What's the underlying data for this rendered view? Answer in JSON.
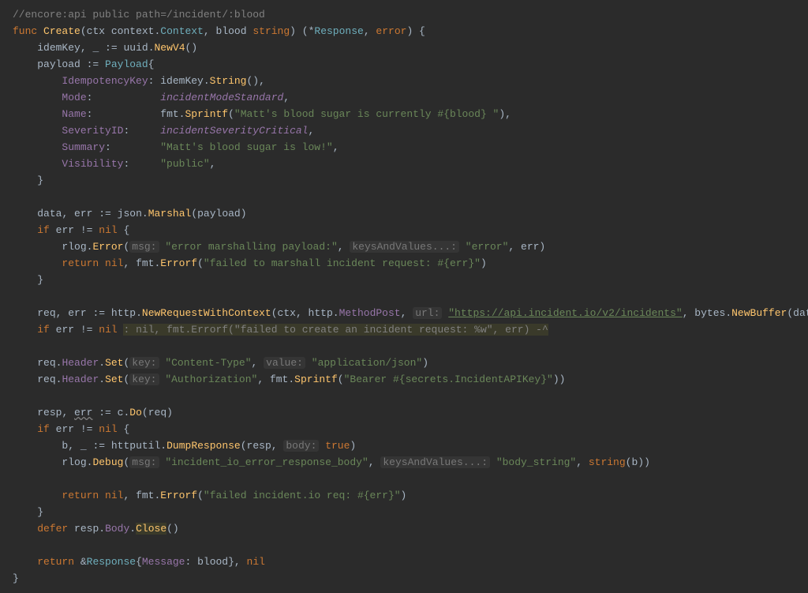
{
  "code": {
    "l1_comment": "//encore:api public path=/incident/:blood",
    "l2_func": "func",
    "l2_name": "Create",
    "l2_ctx": "ctx",
    "l2_context_pkg": "context",
    "l2_context_type": "Context",
    "l2_blood": "blood",
    "l2_string": "string",
    "l2_response": "Response",
    "l2_error": "error",
    "l3_idemKey": "idemKey",
    "l3_discard": "_",
    "l3_uuid": "uuid",
    "l3_newv4": "NewV4",
    "l4_payload": "payload",
    "l4_payload_type": "Payload",
    "l5_field": "IdempotencyKey",
    "l5_idemKey": "idemKey",
    "l5_string": "String",
    "l6_field": "Mode",
    "l6_val": "incidentModeStandard",
    "l7_field": "Name",
    "l7_fmt": "fmt",
    "l7_sprintf": "Sprintf",
    "l7_str": "\"Matt's blood sugar is currently #{blood} \"",
    "l8_field": "SeverityID",
    "l8_val": "incidentSeverityCritical",
    "l9_field": "Summary",
    "l9_val": "\"Matt's blood sugar is low!\"",
    "l10_field": "Visibility",
    "l10_val": "\"public\"",
    "l12_data": "data",
    "l12_err": "err",
    "l12_json": "json",
    "l12_marshal": "Marshal",
    "l12_payload": "payload",
    "l13_if": "if",
    "l13_err": "err",
    "l13_nil": "nil",
    "l14_rlog": "rlog",
    "l14_error": "Error",
    "l14_hint_msg": "msg:",
    "l14_msg_str": "\"error marshalling payload:\"",
    "l14_hint_kv": "keysAndValues...:",
    "l14_kv_str": "\"error\"",
    "l14_err": "err",
    "l15_return": "return",
    "l15_nil": "nil",
    "l15_fmt": "fmt",
    "l15_errorf": "Errorf",
    "l15_str": "\"failed to marshall incident request: #{err}\"",
    "l17_req": "req",
    "l17_err": "err",
    "l17_http": "http",
    "l17_nrwc": "NewRequestWithContext",
    "l17_ctx": "ctx",
    "l17_http2": "http",
    "l17_methodpost": "MethodPost",
    "l17_hint_url": "url:",
    "l17_url_str": "\"https://api.incident.io/v2/incidents\"",
    "l17_bytes": "bytes",
    "l17_newbuffer": "NewBuffer",
    "l17_data": "data",
    "l18_if": "if",
    "l18_err": "err",
    "l18_nil": "nil",
    "l18_collapsed": ": nil, fmt.Errorf(\"failed to create an incident request: %w\", err) -^",
    "l19_req": "req",
    "l19_header": "Header",
    "l19_set": "Set",
    "l19_hint_key": "key:",
    "l19_key_str": "\"Content-Type\"",
    "l19_hint_val": "value:",
    "l19_val_str": "\"application/json\"",
    "l20_req": "req",
    "l20_header": "Header",
    "l20_set": "Set",
    "l20_hint_key": "key:",
    "l20_key_str": "\"Authorization\"",
    "l20_fmt": "fmt",
    "l20_sprintf": "Sprintf",
    "l20_str": "\"Bearer #{secrets.IncidentAPIKey}\"",
    "l21_resp": "resp",
    "l21_err": "err",
    "l21_c": "c",
    "l21_do": "Do",
    "l21_req": "req",
    "l22_if": "if",
    "l22_err": "err",
    "l22_nil": "nil",
    "l23_b": "b",
    "l23_discard": "_",
    "l23_httputil": "httputil",
    "l23_dumpresponse": "DumpResponse",
    "l23_resp": "resp",
    "l23_hint_body": "body:",
    "l23_true": "true",
    "l24_rlog": "rlog",
    "l24_debug": "Debug",
    "l24_hint_msg": "msg:",
    "l24_msg_str": "\"incident_io_error_response_body\"",
    "l24_hint_kv": "keysAndValues...:",
    "l24_kv_str": "\"body_string\"",
    "l24_string": "string",
    "l24_b": "b",
    "l25_return": "return",
    "l25_nil": "nil",
    "l25_fmt": "fmt",
    "l25_errorf": "Errorf",
    "l25_str": "\"failed incident.io req: #{err}\"",
    "l26_defer": "defer",
    "l26_resp": "resp",
    "l26_body": "Body",
    "l26_close": "Close",
    "l27_return": "return",
    "l27_response": "Response",
    "l27_message": "Message",
    "l27_blood": "blood",
    "l27_nil": "nil"
  }
}
